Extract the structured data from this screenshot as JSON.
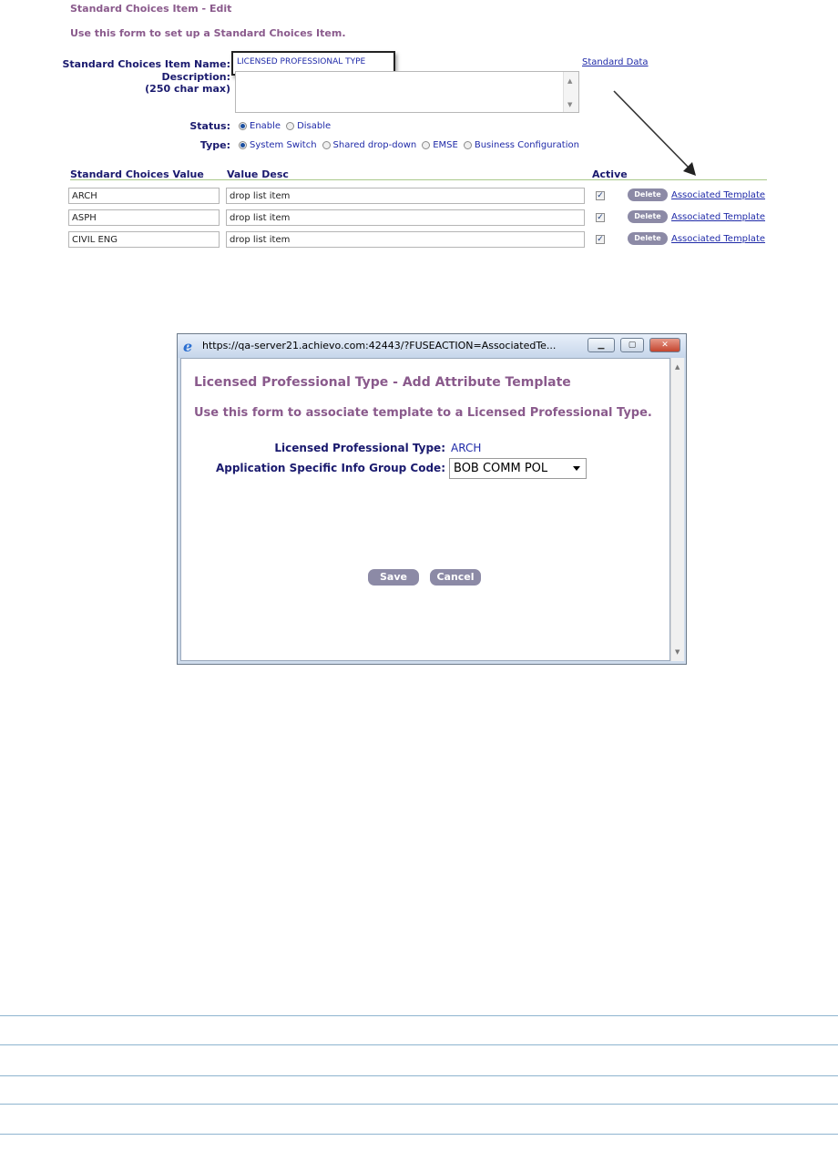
{
  "form": {
    "title": "Standard Choices Item - Edit",
    "intro": "Use this form to set up a Standard Choices Item.",
    "item_name_label": "Standard Choices Item Name:",
    "item_name_value": "LICENSED PROFESSIONAL TYPE",
    "standard_data_link": "Standard Data",
    "description_label": "Description:",
    "description_hint": "(250 char max)",
    "description_value": "",
    "status_label": "Status:",
    "status_options": [
      "Enable",
      "Disable"
    ],
    "status_selected": "Enable",
    "type_label": "Type:",
    "type_options": [
      "System Switch",
      "Shared drop-down",
      "EMSE",
      "Business Configuration"
    ],
    "type_selected": "System Switch"
  },
  "table": {
    "columns": [
      "Standard Choices Value",
      "Value Desc",
      "Active"
    ],
    "delete_label": "Delete",
    "template_link": "Associated Template",
    "rows": [
      {
        "value": "ARCH",
        "desc": "drop list item",
        "active": true
      },
      {
        "value": "ASPH",
        "desc": "drop list item",
        "active": true
      },
      {
        "value": "CIVIL ENG",
        "desc": "drop list item",
        "active": true
      }
    ]
  },
  "popup": {
    "url": "https://qa-server21.achievo.com:42443/?FUSEACTION=AssociatedTe...",
    "title": "Licensed Professional Type - Add Attribute Template",
    "intro": "Use this form to associate template to a Licensed Professional Type.",
    "lp_type_label": "Licensed Professional Type:",
    "lp_type_value": "ARCH",
    "group_code_label": "Application Specific Info Group Code:",
    "group_code_value": "BOB COMM POL",
    "save_label": "Save",
    "cancel_label": "Cancel"
  },
  "colors": {
    "heading": "#8a5a8c",
    "label": "#1a1a6e",
    "link": "#1f2aa8",
    "button": "#8c8aa6"
  },
  "icons": [
    "internet-explorer-icon",
    "minimize-icon",
    "maximize-icon",
    "close-icon",
    "scroll-up-icon",
    "scroll-down-icon",
    "dropdown-caret-icon",
    "checkbox-checked-icon",
    "radio-icon",
    "arrow-icon"
  ]
}
